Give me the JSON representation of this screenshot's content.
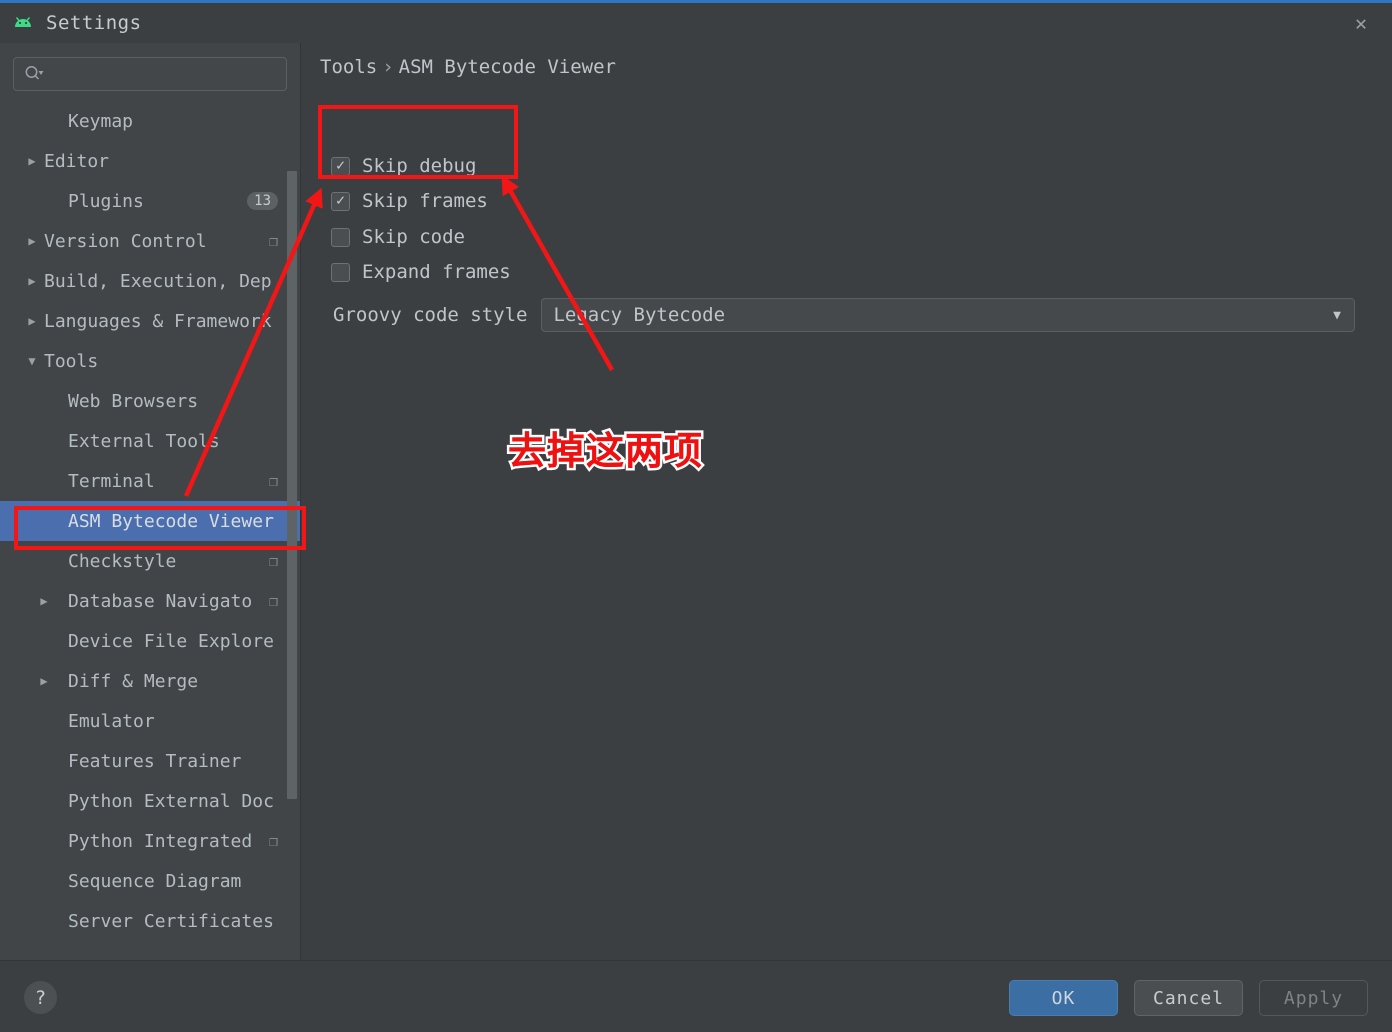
{
  "window": {
    "title": "Settings",
    "app_icon": "android-icon",
    "close_icon": "✕",
    "accent_color": "#2f75c4"
  },
  "sidebar": {
    "search": {
      "value": "",
      "placeholder": "",
      "icon": "search-icon"
    },
    "items": [
      {
        "label": "Keymap",
        "level": 1,
        "arrow": "",
        "badge": "",
        "copy": false,
        "selected": false
      },
      {
        "label": "Editor",
        "level": 0,
        "arrow": "▶",
        "badge": "",
        "copy": false,
        "selected": false
      },
      {
        "label": "Plugins",
        "level": 1,
        "arrow": "",
        "badge": "13",
        "copy": false,
        "selected": false
      },
      {
        "label": "Version Control",
        "level": 0,
        "arrow": "▶",
        "badge": "",
        "copy": true,
        "selected": false
      },
      {
        "label": "Build, Execution, Dep",
        "level": 0,
        "arrow": "▶",
        "badge": "",
        "copy": false,
        "selected": false
      },
      {
        "label": "Languages & Framework",
        "level": 0,
        "arrow": "▶",
        "badge": "",
        "copy": false,
        "selected": false
      },
      {
        "label": "Tools",
        "level": 0,
        "arrow": "▼",
        "badge": "",
        "copy": false,
        "selected": false
      },
      {
        "label": "Web Browsers",
        "level": 1,
        "arrow": "",
        "badge": "",
        "copy": false,
        "selected": false
      },
      {
        "label": "External Tools",
        "level": 1,
        "arrow": "",
        "badge": "",
        "copy": false,
        "selected": false
      },
      {
        "label": "Terminal",
        "level": 1,
        "arrow": "",
        "badge": "",
        "copy": true,
        "selected": false
      },
      {
        "label": "ASM Bytecode Viewer",
        "level": 1,
        "arrow": "",
        "badge": "",
        "copy": false,
        "selected": true
      },
      {
        "label": "Checkstyle",
        "level": 1,
        "arrow": "",
        "badge": "",
        "copy": true,
        "selected": false
      },
      {
        "label": "Database Navigato",
        "level": 1,
        "arrow": "▶",
        "badge": "",
        "copy": true,
        "selected": false
      },
      {
        "label": "Device File Explore",
        "level": 1,
        "arrow": "",
        "badge": "",
        "copy": false,
        "selected": false
      },
      {
        "label": "Diff & Merge",
        "level": 1,
        "arrow": "▶",
        "badge": "",
        "copy": false,
        "selected": false
      },
      {
        "label": "Emulator",
        "level": 1,
        "arrow": "",
        "badge": "",
        "copy": false,
        "selected": false
      },
      {
        "label": "Features Trainer",
        "level": 1,
        "arrow": "",
        "badge": "",
        "copy": false,
        "selected": false
      },
      {
        "label": "Python External Doc",
        "level": 1,
        "arrow": "",
        "badge": "",
        "copy": false,
        "selected": false
      },
      {
        "label": "Python Integrated",
        "level": 1,
        "arrow": "",
        "badge": "",
        "copy": true,
        "selected": false
      },
      {
        "label": "Sequence Diagram",
        "level": 1,
        "arrow": "",
        "badge": "",
        "copy": false,
        "selected": false
      },
      {
        "label": "Server Certificates",
        "level": 1,
        "arrow": "",
        "badge": "",
        "copy": false,
        "selected": false
      }
    ]
  },
  "main": {
    "breadcrumb": {
      "parent": "Tools",
      "separator": "›",
      "current": "ASM Bytecode Viewer"
    },
    "checkboxes": [
      {
        "label": "Skip debug",
        "checked": true
      },
      {
        "label": "Skip frames",
        "checked": true
      },
      {
        "label": "Skip code",
        "checked": false
      },
      {
        "label": "Expand frames",
        "checked": false
      }
    ],
    "groovy": {
      "label": "Groovy code style",
      "value": "Legacy Bytecode",
      "caret": "▼"
    }
  },
  "annotations": {
    "note_text": "去掉这两项",
    "color": "#ee1111",
    "outline_color": "#ffffff"
  },
  "footer": {
    "help_label": "?",
    "ok_label": "OK",
    "cancel_label": "Cancel",
    "apply_label": "Apply"
  }
}
